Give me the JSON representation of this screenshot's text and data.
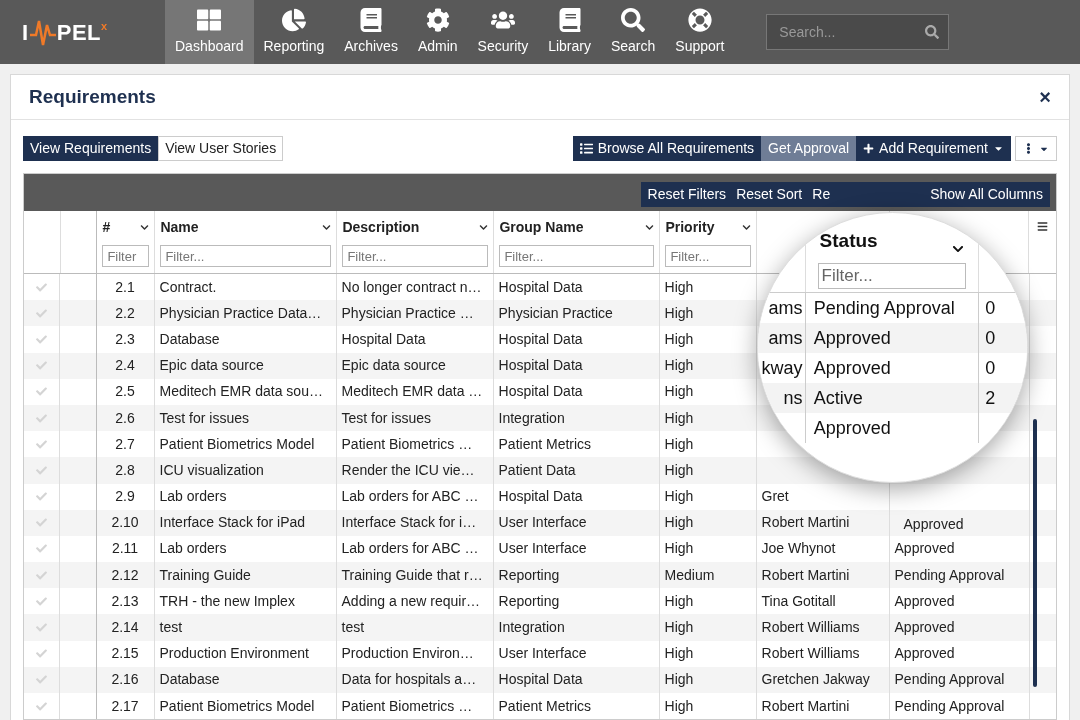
{
  "logo": {
    "left": "I",
    "right": "PEL",
    "mark": "x"
  },
  "nav": [
    {
      "label": "Dashboard",
      "selected": true
    },
    {
      "label": "Reporting",
      "selected": false
    },
    {
      "label": "Archives",
      "selected": false
    },
    {
      "label": "Admin",
      "selected": false
    },
    {
      "label": "Security",
      "selected": false
    },
    {
      "label": "Library",
      "selected": false
    },
    {
      "label": "Search",
      "selected": false
    },
    {
      "label": "Support",
      "selected": false
    }
  ],
  "search": {
    "placeholder": "Search..."
  },
  "panel": {
    "title": "Requirements",
    "close": "×"
  },
  "view_toggle": [
    {
      "label": "View Requirements",
      "selected": true
    },
    {
      "label": "View User Stories",
      "selected": false
    }
  ],
  "actions": [
    {
      "label": "Browse All Requirements",
      "kind": "list",
      "selected": false
    },
    {
      "label": "Get Approval",
      "kind": "plain",
      "selected": true
    },
    {
      "label": "Add Requirement",
      "kind": "add",
      "selected": false
    },
    {
      "kind": "more",
      "selected": false
    }
  ],
  "grid_toolbar": [
    "Reset Filters",
    "Reset Sort",
    "Re",
    "Show All Columns"
  ],
  "table": {
    "columns": [
      {
        "label": "#",
        "placeholder": "Filter"
      },
      {
        "label": "Name",
        "placeholder": "Filter..."
      },
      {
        "label": "Description",
        "placeholder": "Filter..."
      },
      {
        "label": "Group Name",
        "placeholder": "Filter..."
      },
      {
        "label": "Priority",
        "placeholder": "Filter..."
      },
      {}
    ],
    "rows": [
      {
        "num": "2.1",
        "name": "Contract.",
        "description": "No longer contract n…",
        "group": "Hospital Data",
        "priority": "High"
      },
      {
        "num": "2.2",
        "name": "Physician Practice Data…",
        "description": "Physician Practice …",
        "group": "Physician Practice",
        "priority": "High"
      },
      {
        "num": "2.3",
        "name": "Database",
        "description": "Hospital Data",
        "group": "Hospital Data",
        "priority": "High"
      },
      {
        "num": "2.4",
        "name": "Epic data source",
        "description": "Epic data source",
        "group": "Hospital Data",
        "priority": "High"
      },
      {
        "num": "2.5",
        "name": "Meditech EMR data sou…",
        "description": "Meditech EMR data …",
        "group": "Hospital Data",
        "priority": "High"
      },
      {
        "num": "2.6",
        "name": "Test for issues",
        "description": "Test for issues",
        "group": "Integration",
        "priority": "High"
      },
      {
        "num": "2.7",
        "name": "Patient Biometrics Model",
        "description": "Patient Biometrics …",
        "group": "Patient Metrics",
        "priority": "High"
      },
      {
        "num": "2.8",
        "name": "ICU visualization",
        "description": "Render the ICU vie…",
        "group": "Patient Data",
        "priority": "High"
      },
      {
        "num": "2.9",
        "name": "Lab orders",
        "description": "Lab orders for ABC …",
        "group": "Hospital Data",
        "priority": "High",
        "owner": "Gret"
      },
      {
        "num": "2.10",
        "name": "Interface Stack for iPad",
        "description": "Interface Stack for i…",
        "group": "User Interface",
        "priority": "High",
        "owner": "Robert Martini",
        "status": "Approved"
      },
      {
        "num": "2.11",
        "name": "Lab orders",
        "description": "Lab orders for ABC …",
        "group": "User Interface",
        "priority": "High",
        "owner": "Joe Whynot",
        "status": "Approved"
      },
      {
        "num": "2.12",
        "name": "Training Guide",
        "description": "Training Guide that r…",
        "group": "Reporting",
        "priority": "Medium",
        "owner": "Robert Martini",
        "status": "Pending Approval"
      },
      {
        "num": "2.13",
        "name": "TRH - the new Implex",
        "description": "Adding a new requir…",
        "group": "Reporting",
        "priority": "High",
        "owner": "Tina Gotitall",
        "status": "Approved"
      },
      {
        "num": "2.14",
        "name": "test",
        "description": "test",
        "group": "Integration",
        "priority": "High",
        "owner": "Robert Williams",
        "status": "Approved"
      },
      {
        "num": "2.15",
        "name": "Production Environment",
        "description": "Production Environ…",
        "group": "User Interface",
        "priority": "High",
        "owner": "Robert Williams",
        "status": "Approved"
      },
      {
        "num": "2.16",
        "name": "Database",
        "description": "Data for hospitals a…",
        "group": "Hospital Data",
        "priority": "High",
        "owner": "Gretchen Jakway",
        "status": "Pending Approval"
      },
      {
        "num": "2.17",
        "name": "Patient Biometrics Model",
        "description": "Patient Biometrics …",
        "group": "Patient Metrics",
        "priority": "High",
        "owner": "Robert Martini",
        "status": "Pending Approval"
      }
    ]
  },
  "magnifier": {
    "header": "Status",
    "placeholder": "Filter...",
    "rows": [
      {
        "owner": "ams",
        "status": "Pending Approval",
        "count": "0"
      },
      {
        "owner": "ams",
        "status": "Approved",
        "count": "0"
      },
      {
        "owner": "kway",
        "status": "Approved",
        "count": "0"
      },
      {
        "owner": "ns",
        "status": "Active",
        "count": "2"
      },
      {
        "status": "Approved"
      }
    ]
  }
}
